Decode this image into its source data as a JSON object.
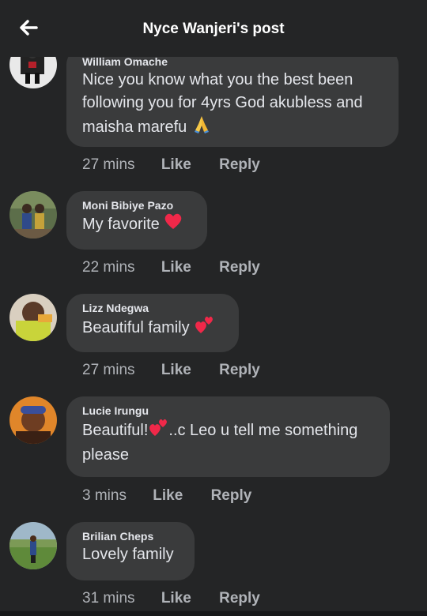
{
  "header": {
    "title": "Nyce Wanjeri's post",
    "back_icon": "arrow-left-icon"
  },
  "colors": {
    "background": "#242526",
    "bubble": "#3a3b3c",
    "text": "#e4e6eb",
    "meta": "#b0b3b8",
    "heart": "#f02849"
  },
  "comments": [
    {
      "author": "William Omache",
      "text": "Nice you know what you the best been following you for 4yrs  God akubless and maisha marefu",
      "emoji": "folded-hands-icon",
      "time": "27 mins",
      "like": "Like",
      "reply": "Reply"
    },
    {
      "author": "Moni Bibiye Pazo",
      "text": "My favorite",
      "emoji": "red-heart-icon",
      "time": "22 mins",
      "like": "Like",
      "reply": "Reply"
    },
    {
      "author": "Lizz Ndegwa",
      "text": "Beautiful family",
      "emoji": "two-hearts-icon",
      "time": "27 mins",
      "like": "Like",
      "reply": "Reply"
    },
    {
      "author": "Lucie Irungu",
      "text_before": "Beautiful!",
      "text_after": "..c Leo u tell me something please",
      "emoji": "two-hearts-icon",
      "time": "3 mins",
      "like": "Like",
      "reply": "Reply"
    },
    {
      "author": "Brilian Cheps",
      "text": "Lovely family",
      "time": "31 mins",
      "like": "Like",
      "reply": "Reply"
    }
  ]
}
